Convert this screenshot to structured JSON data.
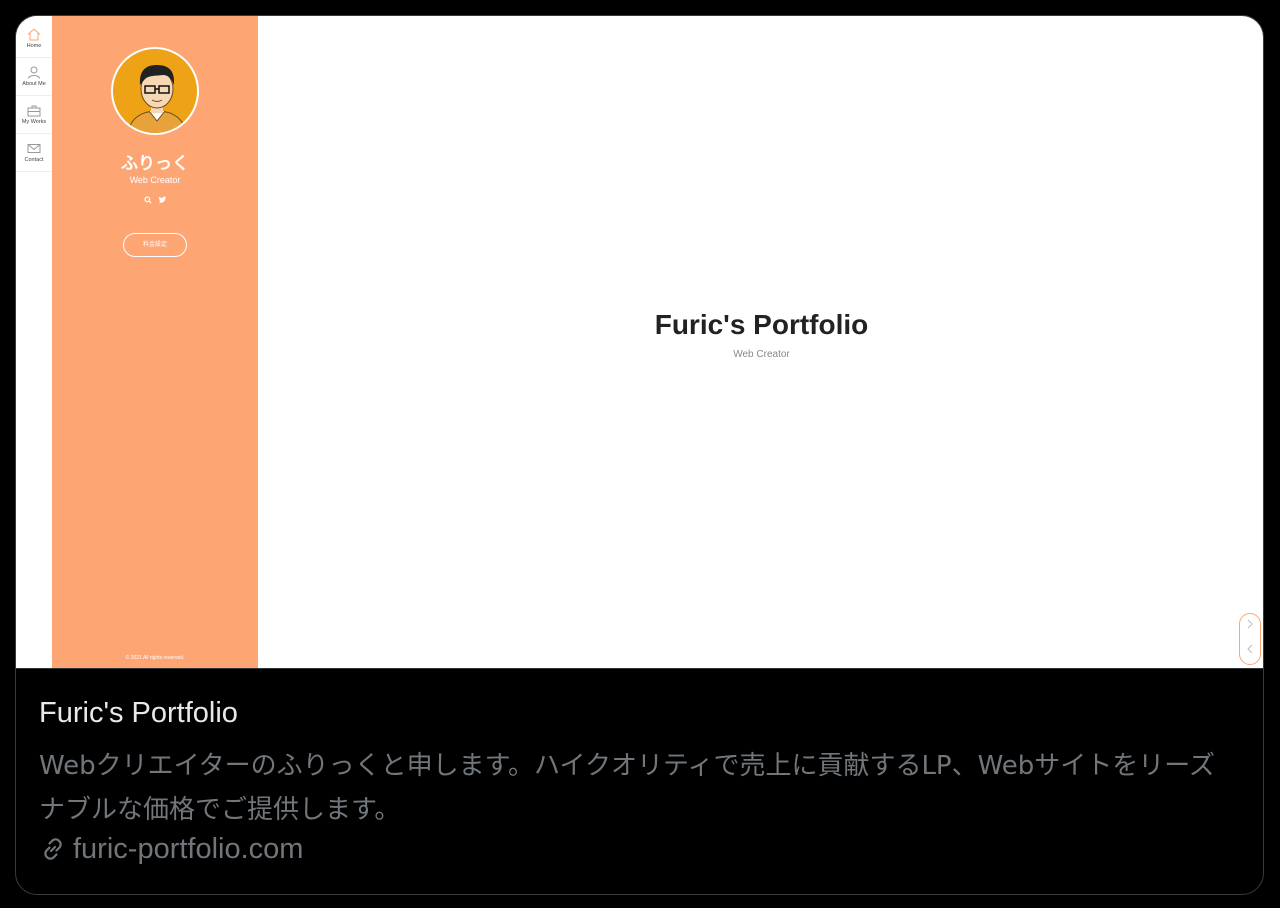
{
  "rail": {
    "items": [
      {
        "label": "Home",
        "icon": "home-icon"
      },
      {
        "label": "About Me",
        "icon": "user-icon"
      },
      {
        "label": "My Works",
        "icon": "briefcase-icon"
      },
      {
        "label": "Contact",
        "icon": "mail-icon"
      }
    ]
  },
  "sidebar": {
    "name": "ふりっく",
    "role": "Web Creator",
    "social": [
      "search-icon",
      "twitter-icon"
    ],
    "price_button": "料金設定",
    "copyright": "© 2021 All rights reserved."
  },
  "hero": {
    "title": "Furic's Portfolio",
    "subtitle": "Web Creator"
  },
  "card": {
    "title": "Furic's Portfolio",
    "description": "Webクリエイターのふりっくと申します。ハイクオリティで売上に貢献するLP、Webサイトをリーズナブルな価格でご提供します。",
    "url": "furic-portfolio.com"
  },
  "colors": {
    "accent": "#fea574",
    "avatar_bg": "#eea316",
    "muted_text": "#71767b",
    "title_text": "#e7e9ea"
  }
}
